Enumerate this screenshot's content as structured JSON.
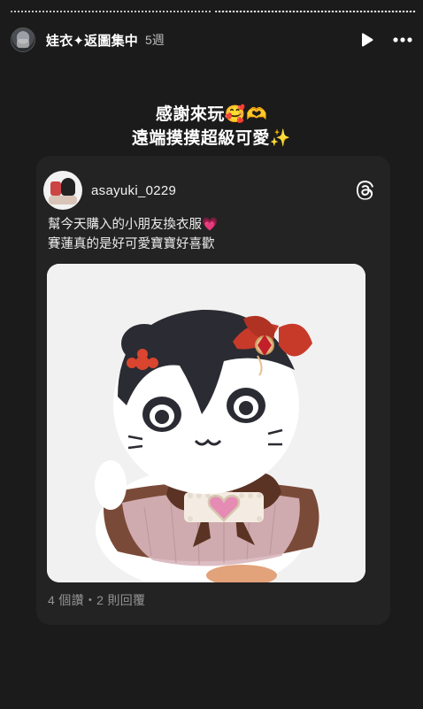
{
  "story": {
    "progress": {
      "segments": 2,
      "active_segment": 2
    },
    "header": {
      "username": "娃衣✦返圖集中",
      "time": "5週",
      "play_icon": "play-icon",
      "more_icon": "more-horizontal-icon"
    },
    "caption": {
      "line1": "感謝來玩🥰🫶",
      "line2": "遠端摸摸超級可愛✨"
    }
  },
  "post": {
    "username": "asayuki_0229",
    "platform_icon": "threads-logo-icon",
    "text_line1": "幫今天購入的小朋友換衣服💗",
    "text_line2": "賽蓮真的是好可愛寶寶好喜歡",
    "stats": "4 個讚・2 則回覆",
    "image_subject": "plush-doll-photo"
  },
  "colors": {
    "background": "#1b1b1b",
    "card": "#232323",
    "text": "#ffffff",
    "muted": "#808080"
  }
}
